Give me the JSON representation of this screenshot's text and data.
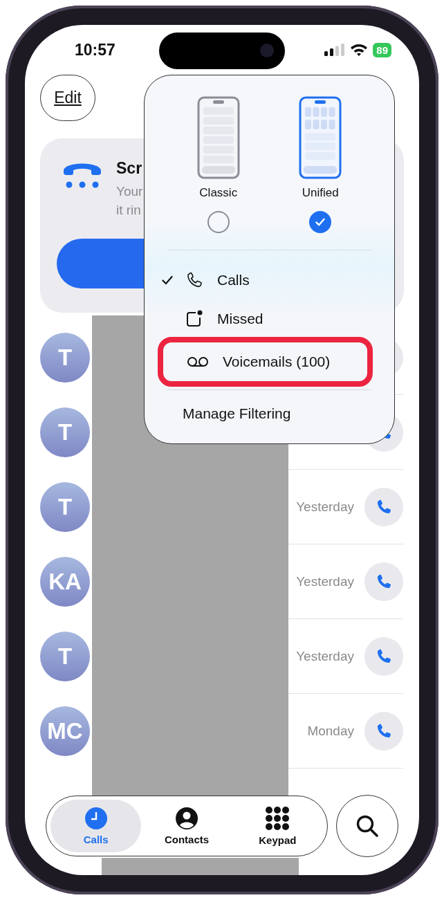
{
  "status_bar": {
    "time": "10:57",
    "battery": "89"
  },
  "edit_button": "Edit",
  "screening_card": {
    "title": "Scr",
    "lines": [
      "Your",
      "it rin"
    ]
  },
  "calls": [
    {
      "initials": "T",
      "call_icon": false
    },
    {
      "initials": "T",
      "call_icon": true
    },
    {
      "initials": "T",
      "date": "Yesterday",
      "call_icon": true
    },
    {
      "initials": "KA",
      "date": "Yesterday",
      "call_icon": true
    },
    {
      "initials": "T",
      "date": "Yesterday",
      "call_icon": true
    },
    {
      "initials": "MC",
      "date": "Monday",
      "call_icon": true
    }
  ],
  "filter_menu": {
    "layouts": [
      {
        "label": "Classic",
        "selected": false
      },
      {
        "label": "Unified",
        "selected": true
      }
    ],
    "items": [
      {
        "label": "Calls",
        "checked": true,
        "highlighted": false
      },
      {
        "label": "Missed",
        "checked": false,
        "highlighted": false
      },
      {
        "label": "Voicemails (100)",
        "checked": false,
        "highlighted": true
      }
    ],
    "manage": "Manage Filtering"
  },
  "tab_bar": {
    "tabs": [
      {
        "label": "Calls",
        "selected": true
      },
      {
        "label": "Contacts",
        "selected": false
      },
      {
        "label": "Keypad",
        "selected": false
      }
    ]
  }
}
